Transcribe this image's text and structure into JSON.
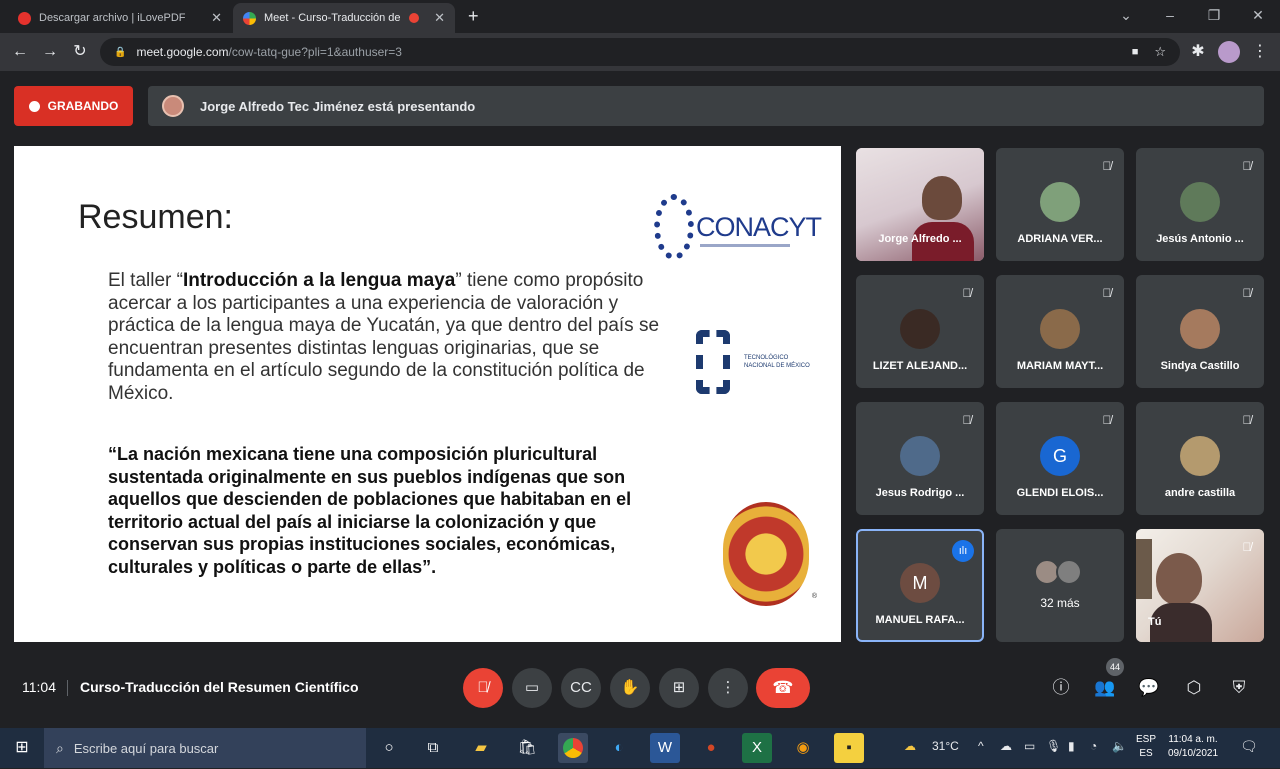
{
  "browser": {
    "tabs": [
      {
        "title": "Descargar archivo | iLovePDF",
        "active": false
      },
      {
        "title": "Meet - Curso-Traducción de",
        "active": true
      }
    ],
    "new_tab": "+",
    "url_host": "meet.google.com",
    "url_path": "/cow-tatq-gue?pli=1&authuser=3",
    "window_controls": [
      "⌄",
      "–",
      "❐",
      "✕"
    ]
  },
  "meet": {
    "recording_label": "GRABANDO",
    "presenting_text": "Jorge Alfredo Tec Jiménez está presentando",
    "time": "11:04",
    "meeting_title": "Curso-Traducción del Resumen Científico",
    "participant_count": "44",
    "more_participants": "32 más",
    "participants": [
      {
        "name": "Jorge Alfredo ...",
        "muted": false
      },
      {
        "name": "ADRIANA VER...",
        "muted": true
      },
      {
        "name": "Jesús Antonio ...",
        "muted": true
      },
      {
        "name": "LIZET ALEJAND...",
        "muted": true
      },
      {
        "name": "MARIAM MAYT...",
        "muted": true
      },
      {
        "name": "Sindya Castillo",
        "muted": true
      },
      {
        "name": "Jesus Rodrigo ...",
        "muted": true
      },
      {
        "name": "GLENDI ELOIS...",
        "muted": true,
        "initial": "G"
      },
      {
        "name": "andre castilla",
        "muted": true
      },
      {
        "name": "MANUEL RAFA...",
        "muted": false,
        "initial": "M",
        "speaking": true
      },
      {
        "name": "Tú",
        "muted": true
      }
    ]
  },
  "slide": {
    "title": "Resumen:",
    "para_pre": "El taller “",
    "para_bold": "Introducción a la lengua maya",
    "para_post": "” tiene como propósito acercar a los participantes a una experiencia de valoración y práctica de la lengua maya de Yucatán, ya que dentro del país se encuentran presentes distintas lenguas originarias, que se fundamenta en el artículo segundo de la constitución política de México.",
    "quote": "“La nación mexicana tiene una composición pluricultural sustentada originalmente en sus pueblos indígenas que son aquellos que descienden de poblaciones que habitaban en el territorio actual del país al iniciarse la colonización y que conservan sus propias instituciones sociales, económicas, culturales y políticas o parte de ellas”.",
    "logo_conacyt": "CONACYT",
    "logo_tecnm": "TECNOLÓGICO NACIONAL DE MÉXICO"
  },
  "taskbar": {
    "search_placeholder": "Escribe aquí para buscar",
    "weather": "31°C",
    "lang_top": "ESP",
    "lang_bottom": "ES",
    "clock_time": "11:04 a. m.",
    "clock_date": "09/10/2021"
  },
  "colors": {
    "meet_bg": "#202124",
    "tile_bg": "#3c4043",
    "recording_red": "#d93025",
    "hangup_red": "#ea4335",
    "speaking_blue": "#8ab4f8"
  }
}
